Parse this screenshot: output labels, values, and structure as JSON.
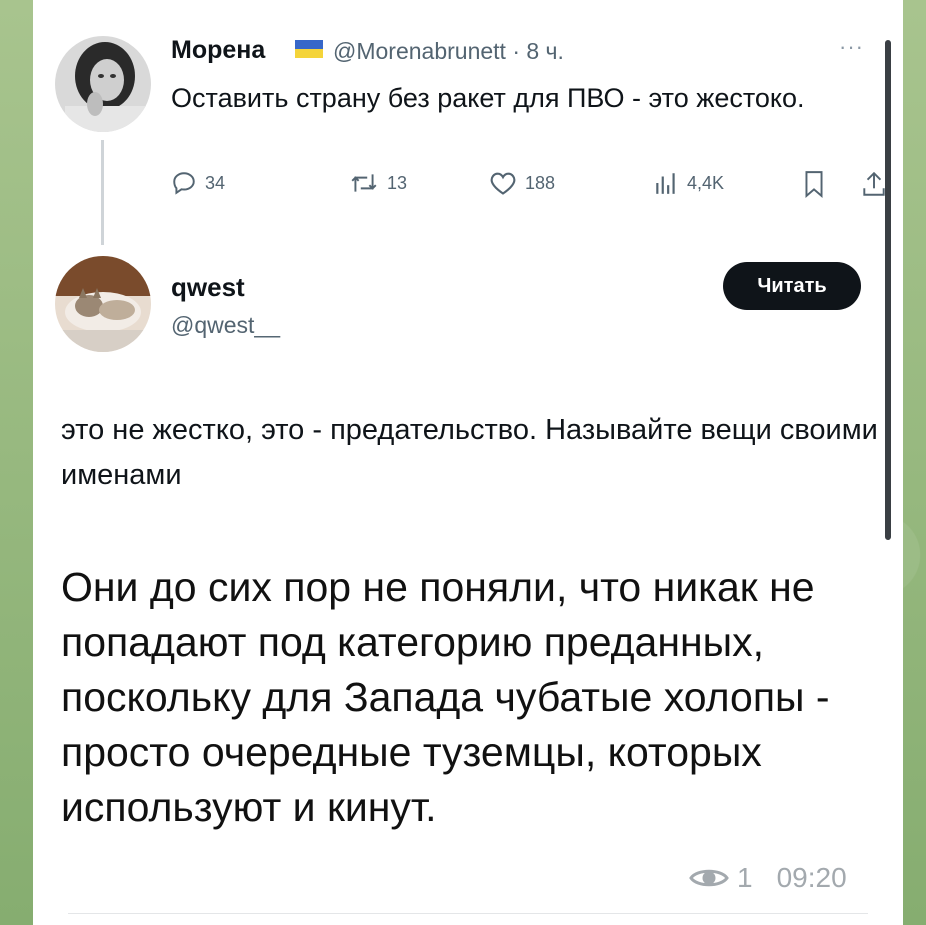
{
  "tweet1": {
    "author_name": "Морена",
    "handle_time": "@Morenabrunett · 8 ч.",
    "more": "···",
    "text": "Оставить страну без ракет для ПВО - это жестоко.",
    "actions": {
      "replies": "34",
      "retweets": "13",
      "likes": "188",
      "views": "4,4K"
    }
  },
  "tweet2": {
    "author_name": "qwest",
    "handle": "@qwest__",
    "read_button": "Читать",
    "text": "это не жестко, это - предательство. Называйте вещи своими именами"
  },
  "message": {
    "text": "Они до сих пор не поняли, что никак не попадают под категорию преданных, поскольку для Запада чубатые холопы - просто очередные туземцы, которых используют и кинут.",
    "views": "1",
    "time": "09:20"
  },
  "colors": {
    "flag_blue": "#3767c9",
    "flag_yellow": "#f4d43a",
    "button_bg": "#0f1419",
    "background": "#8fb37a"
  }
}
